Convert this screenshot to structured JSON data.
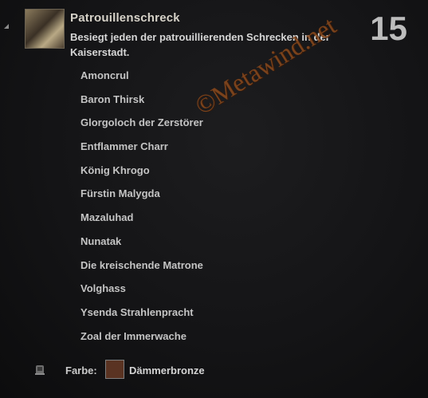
{
  "achievement": {
    "title": "Patrouillenschreck",
    "description": "Besiegt jeden der patrouillierenden Schrecken in der Kaiserstadt.",
    "points": "15",
    "criteria": [
      "Amoncrul",
      "Baron Thirsk",
      "Glorgoloch der Zerstörer",
      "Entflammer Charr",
      "König Khrogo",
      "Fürstin Malygda",
      "Mazaluhad",
      "Nunatak",
      "Die kreischende Matrone",
      "Volghass",
      "Ysenda Strahlenpracht",
      "Zoal der Immerwache"
    ]
  },
  "reward": {
    "label": "Farbe:",
    "name": "Dämmerbronze",
    "color": "#5a3322",
    "icon": "dye-icon"
  },
  "watermark": {
    "text": "©Metawind.net"
  }
}
